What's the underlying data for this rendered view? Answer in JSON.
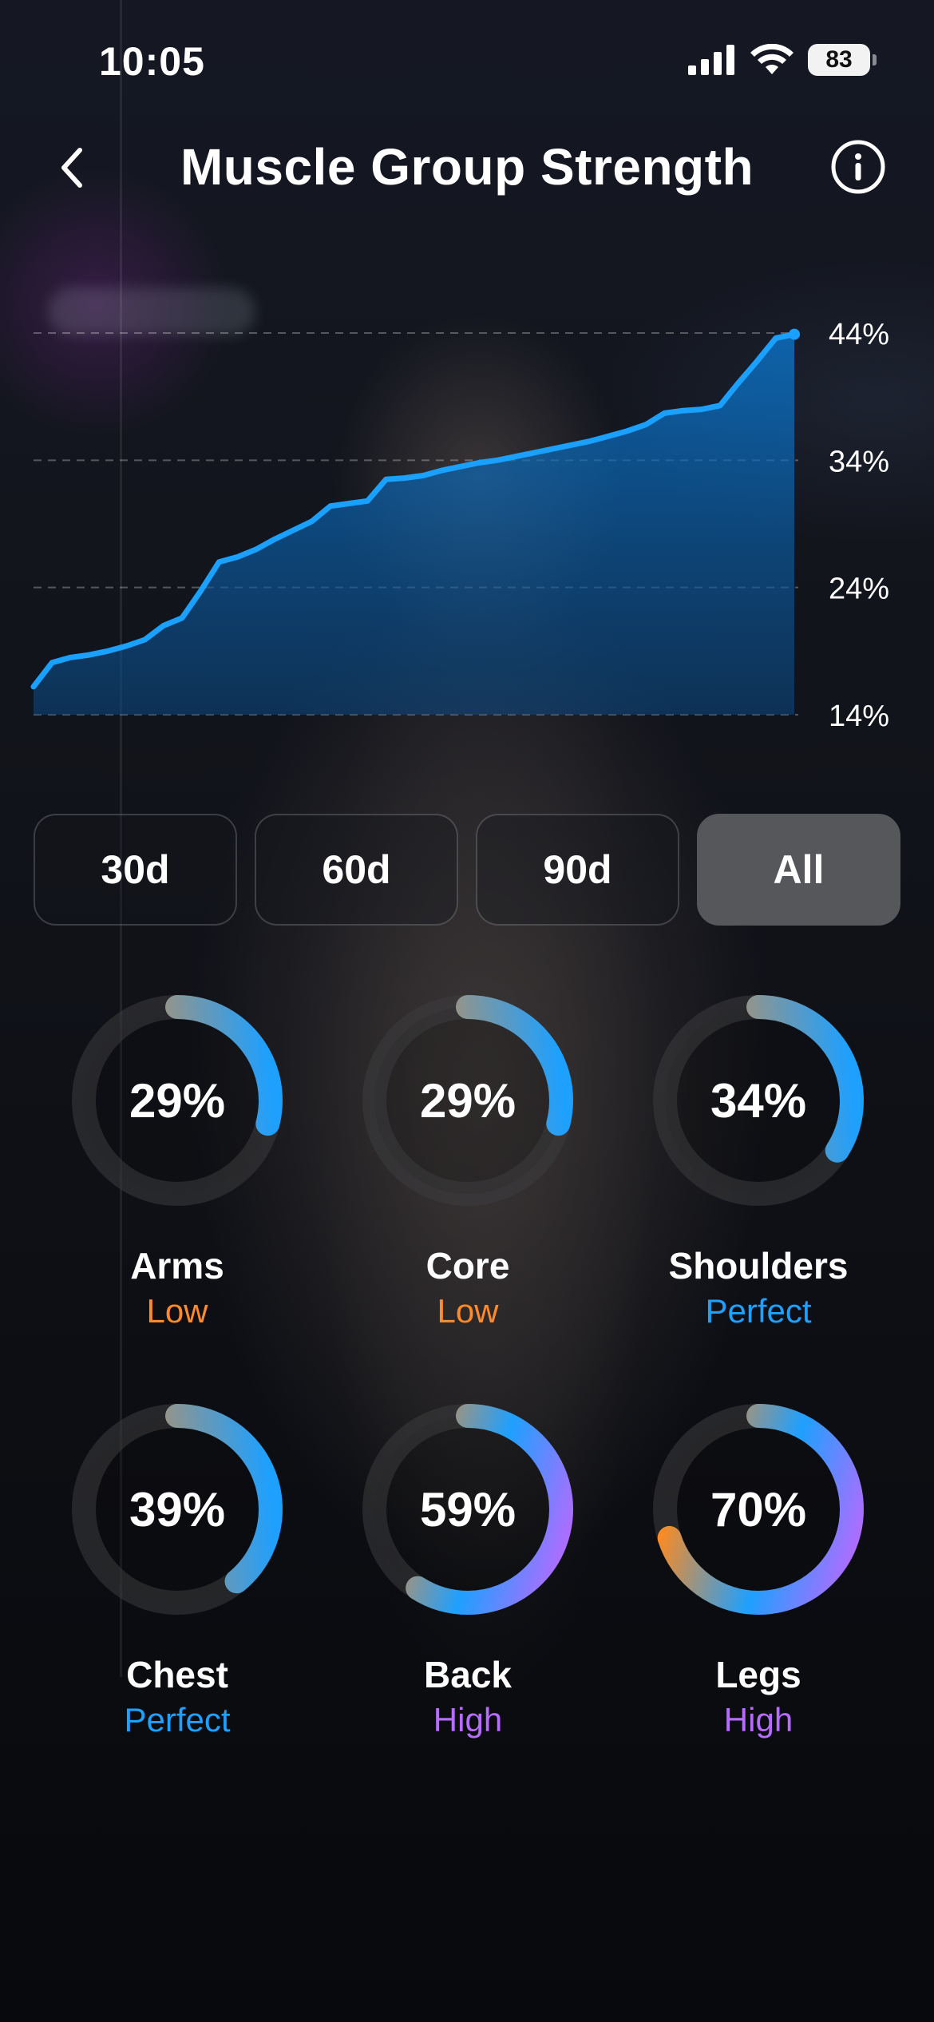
{
  "status_bar": {
    "time": "10:05",
    "battery": "83"
  },
  "header": {
    "title": "Muscle Group Strength"
  },
  "chart_data": {
    "type": "area",
    "y_tick_labels": [
      "44%",
      "34%",
      "24%",
      "14%"
    ],
    "ylim": [
      14,
      44
    ],
    "grid": true,
    "series": [
      {
        "values": [
          16.2,
          18.1,
          18.5,
          18.7,
          19.0,
          19.4,
          19.9,
          21.0,
          21.6,
          23.7,
          26.0,
          26.4,
          27.0,
          27.8,
          28.5,
          29.2,
          30.4,
          30.6,
          30.8,
          32.5,
          32.6,
          32.8,
          33.2,
          33.5,
          33.8,
          34.0,
          34.3,
          34.6,
          34.9,
          35.2,
          35.5,
          35.9,
          36.3,
          36.8,
          37.7,
          37.9,
          38.0,
          38.3,
          40.1,
          41.8,
          43.6,
          43.9
        ]
      }
    ],
    "colors": {
      "line": "#1aa0ff",
      "fill": "#0a6ab8"
    }
  },
  "periods": {
    "items": [
      {
        "label": "30d",
        "active": false
      },
      {
        "label": "60d",
        "active": false
      },
      {
        "label": "90d",
        "active": false
      },
      {
        "label": "All",
        "active": true
      }
    ]
  },
  "muscles": [
    {
      "name": "Arms",
      "percent": 29,
      "label": "29%",
      "status": "Low",
      "status_color": "#ff8a2a"
    },
    {
      "name": "Core",
      "percent": 29,
      "label": "29%",
      "status": "Low",
      "status_color": "#ff8a2a"
    },
    {
      "name": "Shoulders",
      "percent": 34,
      "label": "34%",
      "status": "Perfect",
      "status_color": "#1ea0ff"
    },
    {
      "name": "Chest",
      "percent": 39,
      "label": "39%",
      "status": "Perfect",
      "status_color": "#1ea0ff"
    },
    {
      "name": "Back",
      "percent": 59,
      "label": "59%",
      "status": "High",
      "status_color": "#b86cff"
    },
    {
      "name": "Legs",
      "percent": 70,
      "label": "70%",
      "status": "High",
      "status_color": "#b86cff"
    }
  ],
  "icons": {
    "back": "chevron-left-icon",
    "info": "info-icon"
  },
  "colors": {
    "orange": "#ff8a1e",
    "blue": "#1ea0ff",
    "purple": "#b06cff"
  }
}
